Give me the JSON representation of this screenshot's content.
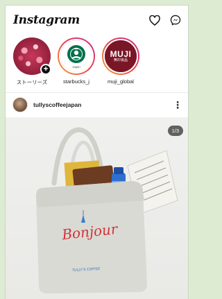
{
  "app": {
    "logo_text": "Instagram"
  },
  "header_icons": [
    "heart-icon",
    "messenger-icon"
  ],
  "stories": [
    {
      "label": "ストーリーズ",
      "kind": "own"
    },
    {
      "label": "starbucks_j",
      "kind": "starbucks"
    },
    {
      "label": "muji_global",
      "kind": "muji",
      "logo_main": "MUJI",
      "logo_sub": "無印良品"
    }
  ],
  "starbucks_sub": "Japan",
  "post": {
    "username": "tullyscoffeejapan",
    "image_counter": "1/3",
    "bag_script": "Bonjour",
    "bag_brand": "TULLY'S COFFEE"
  },
  "colors": {
    "background": "#dcebd2",
    "story_ring_start": "#f9a43c",
    "story_ring_end": "#c42e8e",
    "muji_red": "#7a1726",
    "starbucks_green": "#00704a"
  }
}
